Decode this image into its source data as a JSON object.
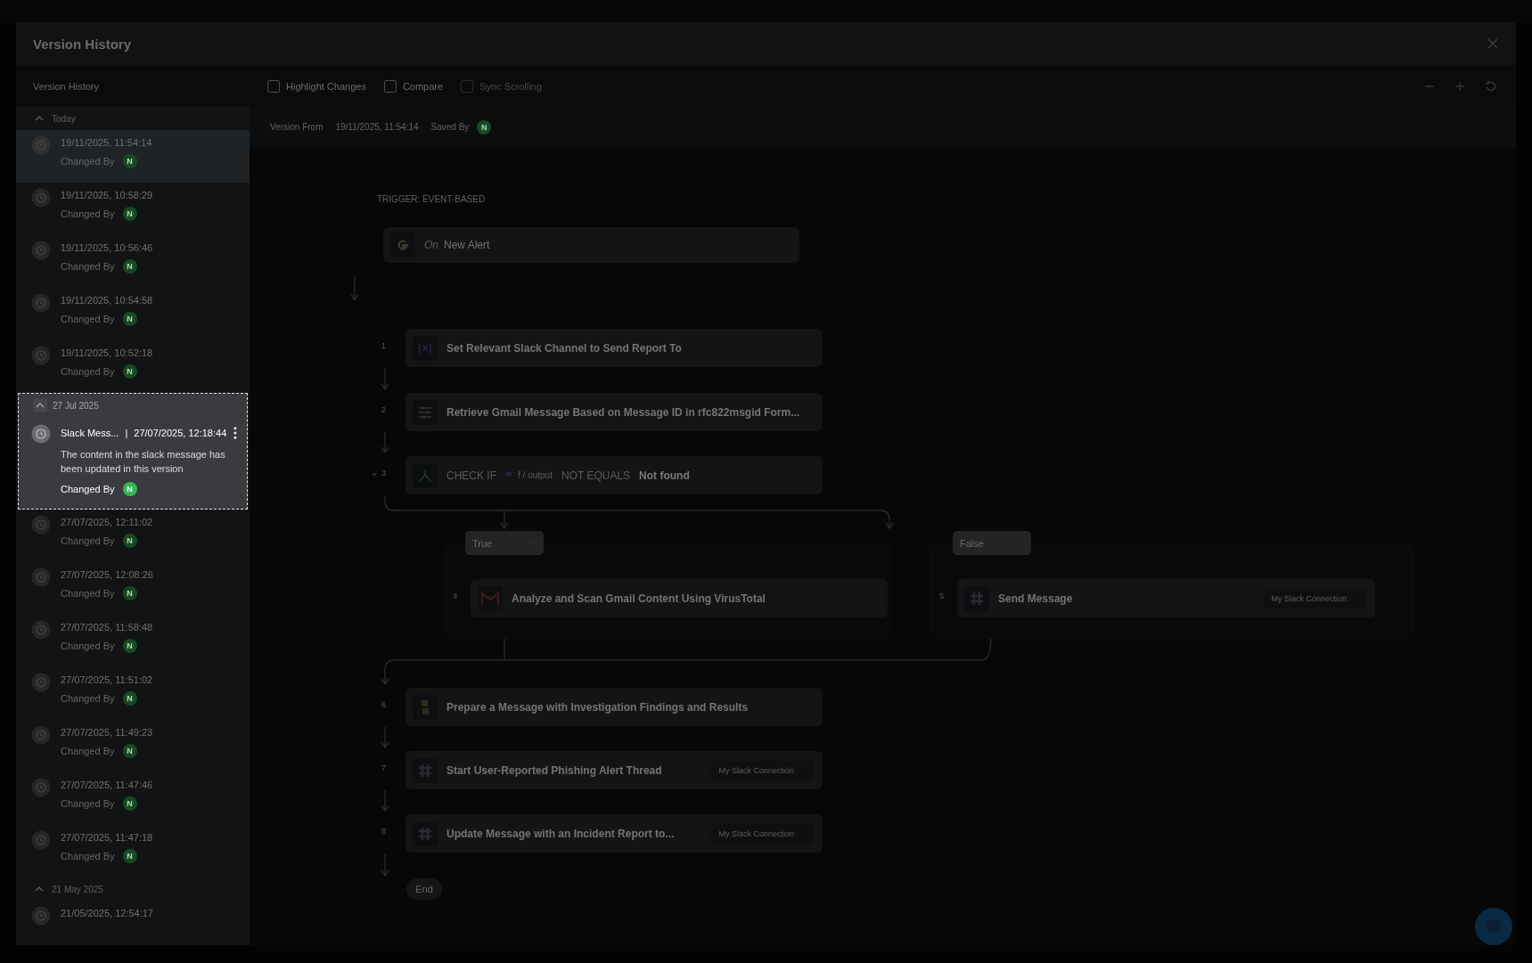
{
  "modal": {
    "title": "Version History"
  },
  "sidebar": {
    "title": "Version History",
    "groups": [
      {
        "label": "Today",
        "expanded": true,
        "spotlight": false,
        "versions": [
          {
            "time": "19/11/2025, 11:54:14",
            "changed_by_label": "Changed By",
            "avatar": "N",
            "selected": true
          },
          {
            "time": "19/11/2025, 10:58:29",
            "changed_by_label": "Changed By",
            "avatar": "N",
            "selected": false
          },
          {
            "time": "19/11/2025, 10:56:46",
            "changed_by_label": "Changed By",
            "avatar": "N",
            "selected": false
          },
          {
            "time": "19/11/2025, 10:54:58",
            "changed_by_label": "Changed By",
            "avatar": "N",
            "selected": false
          },
          {
            "time": "19/11/2025, 10:52:18",
            "changed_by_label": "Changed By",
            "avatar": "N",
            "selected": false
          }
        ]
      },
      {
        "label": "27 Jul 2025",
        "expanded": true,
        "spotlight": true,
        "versions": [
          {
            "name": "Slack Mess...",
            "separator": "|",
            "time": "27/07/2025, 12:18:44",
            "description": "The content in the slack message has been updated in this version",
            "changed_by_label": "Changed By",
            "avatar": "N",
            "selected": false
          },
          {
            "time": "27/07/2025, 12:11:02",
            "changed_by_label": "Changed By",
            "avatar": "N",
            "selected": false
          },
          {
            "time": "27/07/2025, 12:08:26",
            "changed_by_label": "Changed By",
            "avatar": "N",
            "selected": false
          },
          {
            "time": "27/07/2025, 11:58:48",
            "changed_by_label": "Changed By",
            "avatar": "N",
            "selected": false
          },
          {
            "time": "27/07/2025, 11:51:02",
            "changed_by_label": "Changed By",
            "avatar": "N",
            "selected": false
          },
          {
            "time": "27/07/2025, 11:49:23",
            "changed_by_label": "Changed By",
            "avatar": "N",
            "selected": false
          },
          {
            "time": "27/07/2025, 11:47:46",
            "changed_by_label": "Changed By",
            "avatar": "N",
            "selected": false
          },
          {
            "time": "27/07/2025, 11:47:18",
            "changed_by_label": "Changed By",
            "avatar": "N",
            "selected": false
          }
        ]
      },
      {
        "label": "21 May 2025",
        "expanded": true,
        "spotlight": false,
        "versions": [
          {
            "time": "21/05/2025, 12:54:17",
            "selected": false
          }
        ]
      }
    ]
  },
  "toolbar": {
    "options": [
      {
        "label": "Highlight Changes",
        "checked": false,
        "disabled": false
      },
      {
        "label": "Compare",
        "checked": false,
        "disabled": false
      },
      {
        "label": "Sync Scrolling",
        "checked": false,
        "disabled": true
      }
    ]
  },
  "version_info": {
    "from_label": "Version From",
    "from_value": "19/11/2025, 11:54:14",
    "saved_by_label": "Saved By",
    "avatar": "N"
  },
  "flow": {
    "trigger_label": "TRIGGER: EVENT-BASED",
    "trigger": {
      "prefix": "On",
      "name": "New Alert"
    },
    "steps": [
      {
        "kind": "action",
        "number": "1",
        "title": "Set Relevant Slack Channel to Send Report To"
      },
      {
        "kind": "action",
        "number": "2",
        "title": "Retrieve Gmail Message Based on Message ID in rfc822msgid Form..."
      },
      {
        "kind": "condition",
        "number": "3",
        "expanded": true,
        "check_label": "CHECK IF",
        "operand": "f / output",
        "operator": "NOT EQUALS",
        "value": "Not found"
      }
    ],
    "branches": [
      {
        "label": "True",
        "steps": [
          {
            "kind": "action",
            "number": "4",
            "title": "Analyze and Scan Gmail Content Using VirusTotal"
          }
        ]
      },
      {
        "label": "False",
        "steps": [
          {
            "kind": "action",
            "number": "5",
            "title": "Send Message",
            "connection": "My Slack Connection"
          }
        ]
      }
    ],
    "after": [
      {
        "kind": "action",
        "number": "6",
        "title": "Prepare a Message with Investigation Findings and Results"
      },
      {
        "kind": "action",
        "number": "7",
        "title": "Start User-Reported Phishing Alert Thread",
        "connection": "My Slack Connection"
      },
      {
        "kind": "action",
        "number": "8",
        "title": "Update Message with an Incident Report to...",
        "connection": "My Slack Connection"
      }
    ],
    "end": "End"
  }
}
